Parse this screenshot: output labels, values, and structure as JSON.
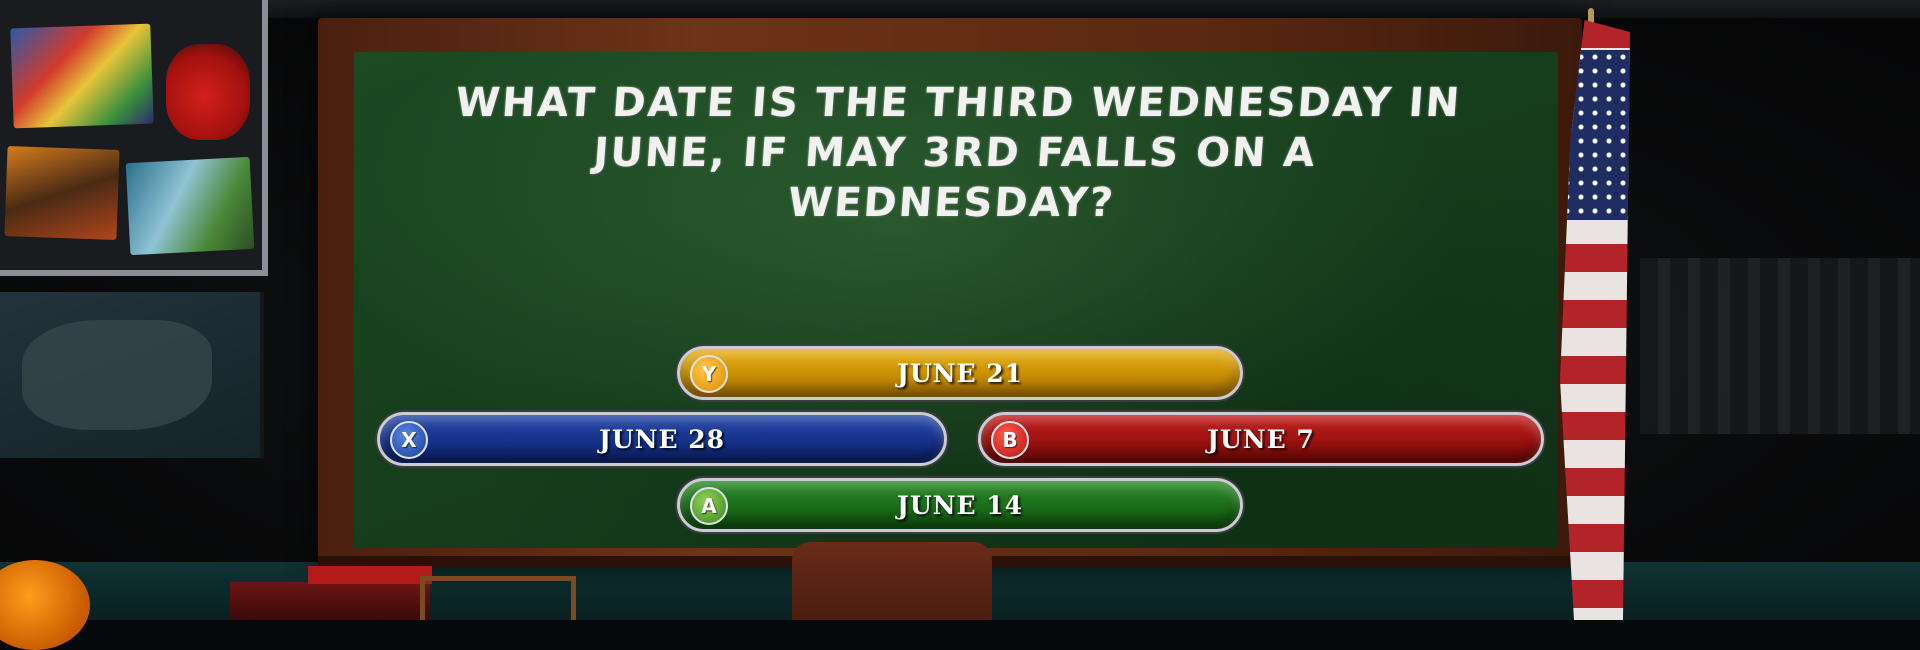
{
  "question": {
    "lines": [
      "WHAT DATE IS THE THIRD WEDNESDAY IN",
      "JUNE, IF MAY 3RD FALLS ON A",
      "WEDNESDAY?"
    ]
  },
  "answers": [
    {
      "button": "Y",
      "label": "JUNE 21",
      "color": "#d9a00f"
    },
    {
      "button": "X",
      "label": "JUNE 28",
      "color": "#1a3a9a"
    },
    {
      "button": "B",
      "label": "JUNE 7",
      "color": "#a8161a"
    },
    {
      "button": "A",
      "label": "JUNE 14",
      "color": "#1f7a1e"
    }
  ],
  "scene": {
    "board_color": "#17401d",
    "frame_color": "#5b2811",
    "props": [
      "bulletin-board",
      "wall-map",
      "american-flag",
      "teacher-chair",
      "books",
      "abacus",
      "pumpkin"
    ]
  }
}
